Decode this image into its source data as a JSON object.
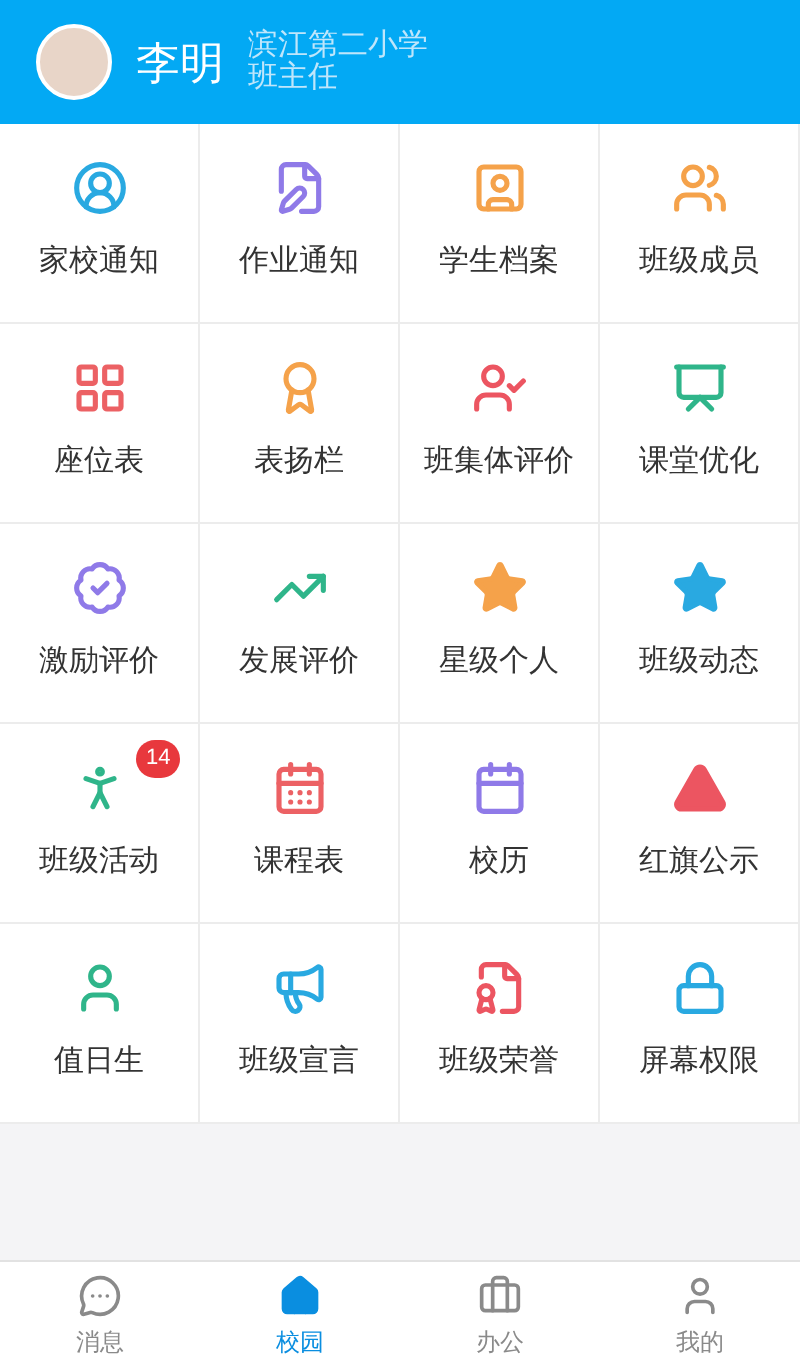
{
  "header": {
    "name": "李明",
    "school": "滨江第二小学",
    "role": "班主任"
  },
  "grid": [
    {
      "label": "家校通知",
      "color": "#29a9e1"
    },
    {
      "label": "作业通知",
      "color": "#8f7ae8"
    },
    {
      "label": "学生档案",
      "color": "#f5a24a"
    },
    {
      "label": "班级成员",
      "color": "#f5a24a"
    },
    {
      "label": "座位表",
      "color": "#ec6164"
    },
    {
      "label": "表扬栏",
      "color": "#f5a24a"
    },
    {
      "label": "班集体评价",
      "color": "#ec5561"
    },
    {
      "label": "课堂优化",
      "color": "#2fb58a"
    },
    {
      "label": "激励评价",
      "color": "#8f7ae8"
    },
    {
      "label": "发展评价",
      "color": "#2fb58a"
    },
    {
      "label": "星级个人",
      "color": "#f5a24a"
    },
    {
      "label": "班级动态",
      "color": "#29a9e1"
    },
    {
      "label": "班级活动",
      "color": "#2fb58a",
      "badge": "14"
    },
    {
      "label": "课程表",
      "color": "#ec6164"
    },
    {
      "label": "校历",
      "color": "#8f7ae8"
    },
    {
      "label": "红旗公示",
      "color": "#ec5561"
    },
    {
      "label": "值日生",
      "color": "#2fb58a"
    },
    {
      "label": "班级宣言",
      "color": "#29a9e1"
    },
    {
      "label": "班级荣誉",
      "color": "#ec5561"
    },
    {
      "label": "屏幕权限",
      "color": "#29a9e1"
    }
  ],
  "nav": [
    {
      "label": "消息",
      "selected": false
    },
    {
      "label": "校园",
      "selected": true
    },
    {
      "label": "办公",
      "selected": false
    },
    {
      "label": "我的",
      "selected": false
    }
  ]
}
